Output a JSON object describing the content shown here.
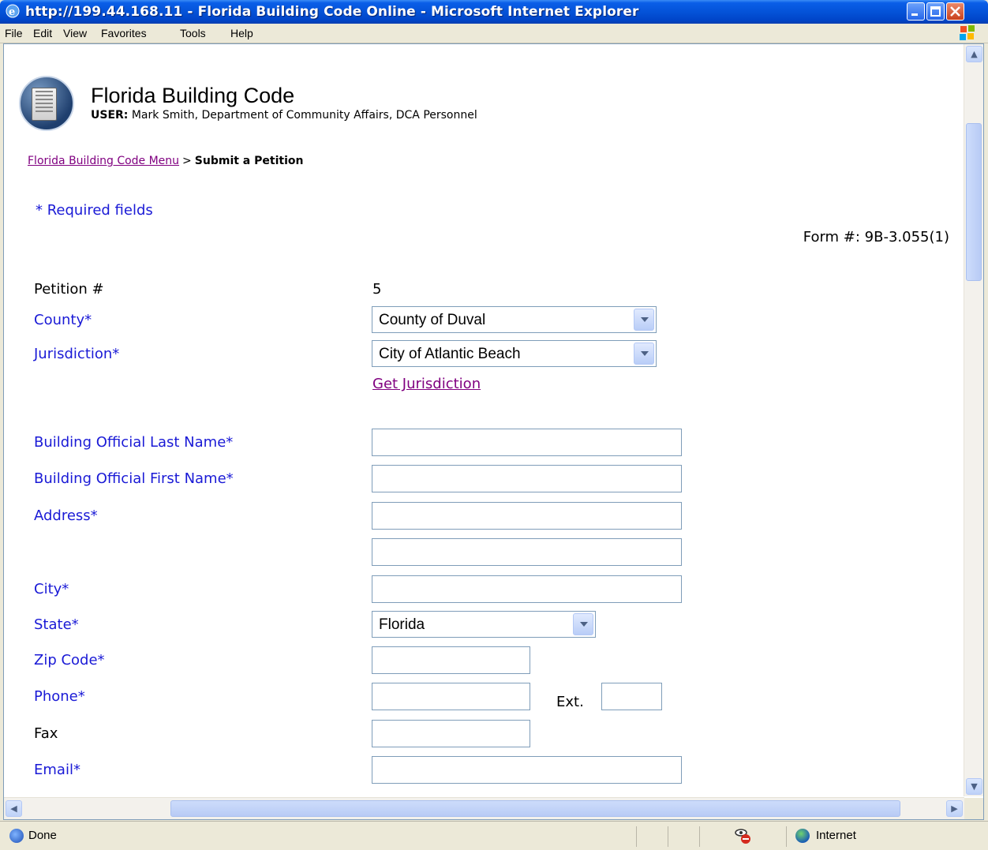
{
  "window": {
    "title": "http://199.44.168.11 - Florida Building Code Online - Microsoft Internet Explorer"
  },
  "menu": {
    "items": [
      {
        "label": "File"
      },
      {
        "label": "Edit"
      },
      {
        "label": "View"
      },
      {
        "label": "Favorites"
      },
      {
        "label": "Tools"
      },
      {
        "label": "Help"
      }
    ]
  },
  "header": {
    "app_title": "Florida Building Code",
    "user_label": "USER:",
    "user_value": " Mark Smith, Department of Community Affairs, DCA Personnel"
  },
  "breadcrumb": {
    "link": "Florida Building Code Menu",
    "separator": ">",
    "current": "Submit a Petition"
  },
  "form": {
    "required_note": "* Required fields",
    "form_number": "Form #: 9B-3.055(1)",
    "petition_label": "Petition #",
    "petition_value": "5",
    "county_label": "County*",
    "county_value": "County of Duval",
    "jurisdiction_label": "Jurisdiction*",
    "jurisdiction_value": "City of Atlantic Beach",
    "get_jurisdiction_link": "Get Jurisdiction",
    "last_name_label": "Building Official Last Name*",
    "first_name_label": "Building Official First Name*",
    "address_label": "Address*",
    "city_label": "City*",
    "state_label": "State*",
    "state_value": "Florida",
    "zip_label": "Zip Code*",
    "phone_label": "Phone*",
    "ext_label": "Ext.",
    "fax_label": "Fax",
    "email_label": "Email*"
  },
  "status": {
    "text": "Done",
    "zone": "Internet"
  },
  "colors": {
    "required_label": "#1a1ad6",
    "visited_link": "#800080",
    "titlebar": "#0453d8"
  }
}
